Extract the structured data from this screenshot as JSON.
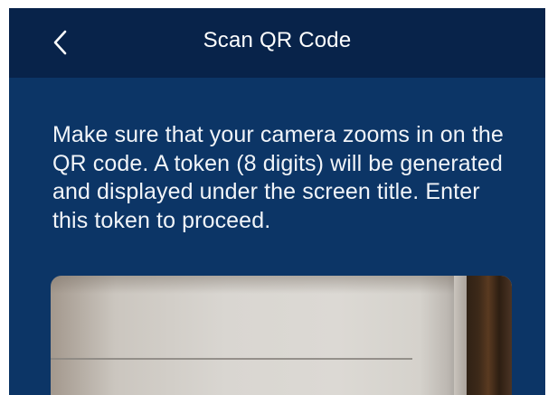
{
  "header": {
    "title": "Scan QR Code",
    "back_icon": "chevron-left-icon"
  },
  "main": {
    "instruction": "Make sure that your camera zooms in on the QR code. A token (8 digits) will be generated and displayed under the screen title. Enter this token to proceed."
  },
  "colors": {
    "header_background": "#08234a",
    "screen_background": "#0c3566",
    "text": "#ffffff"
  }
}
